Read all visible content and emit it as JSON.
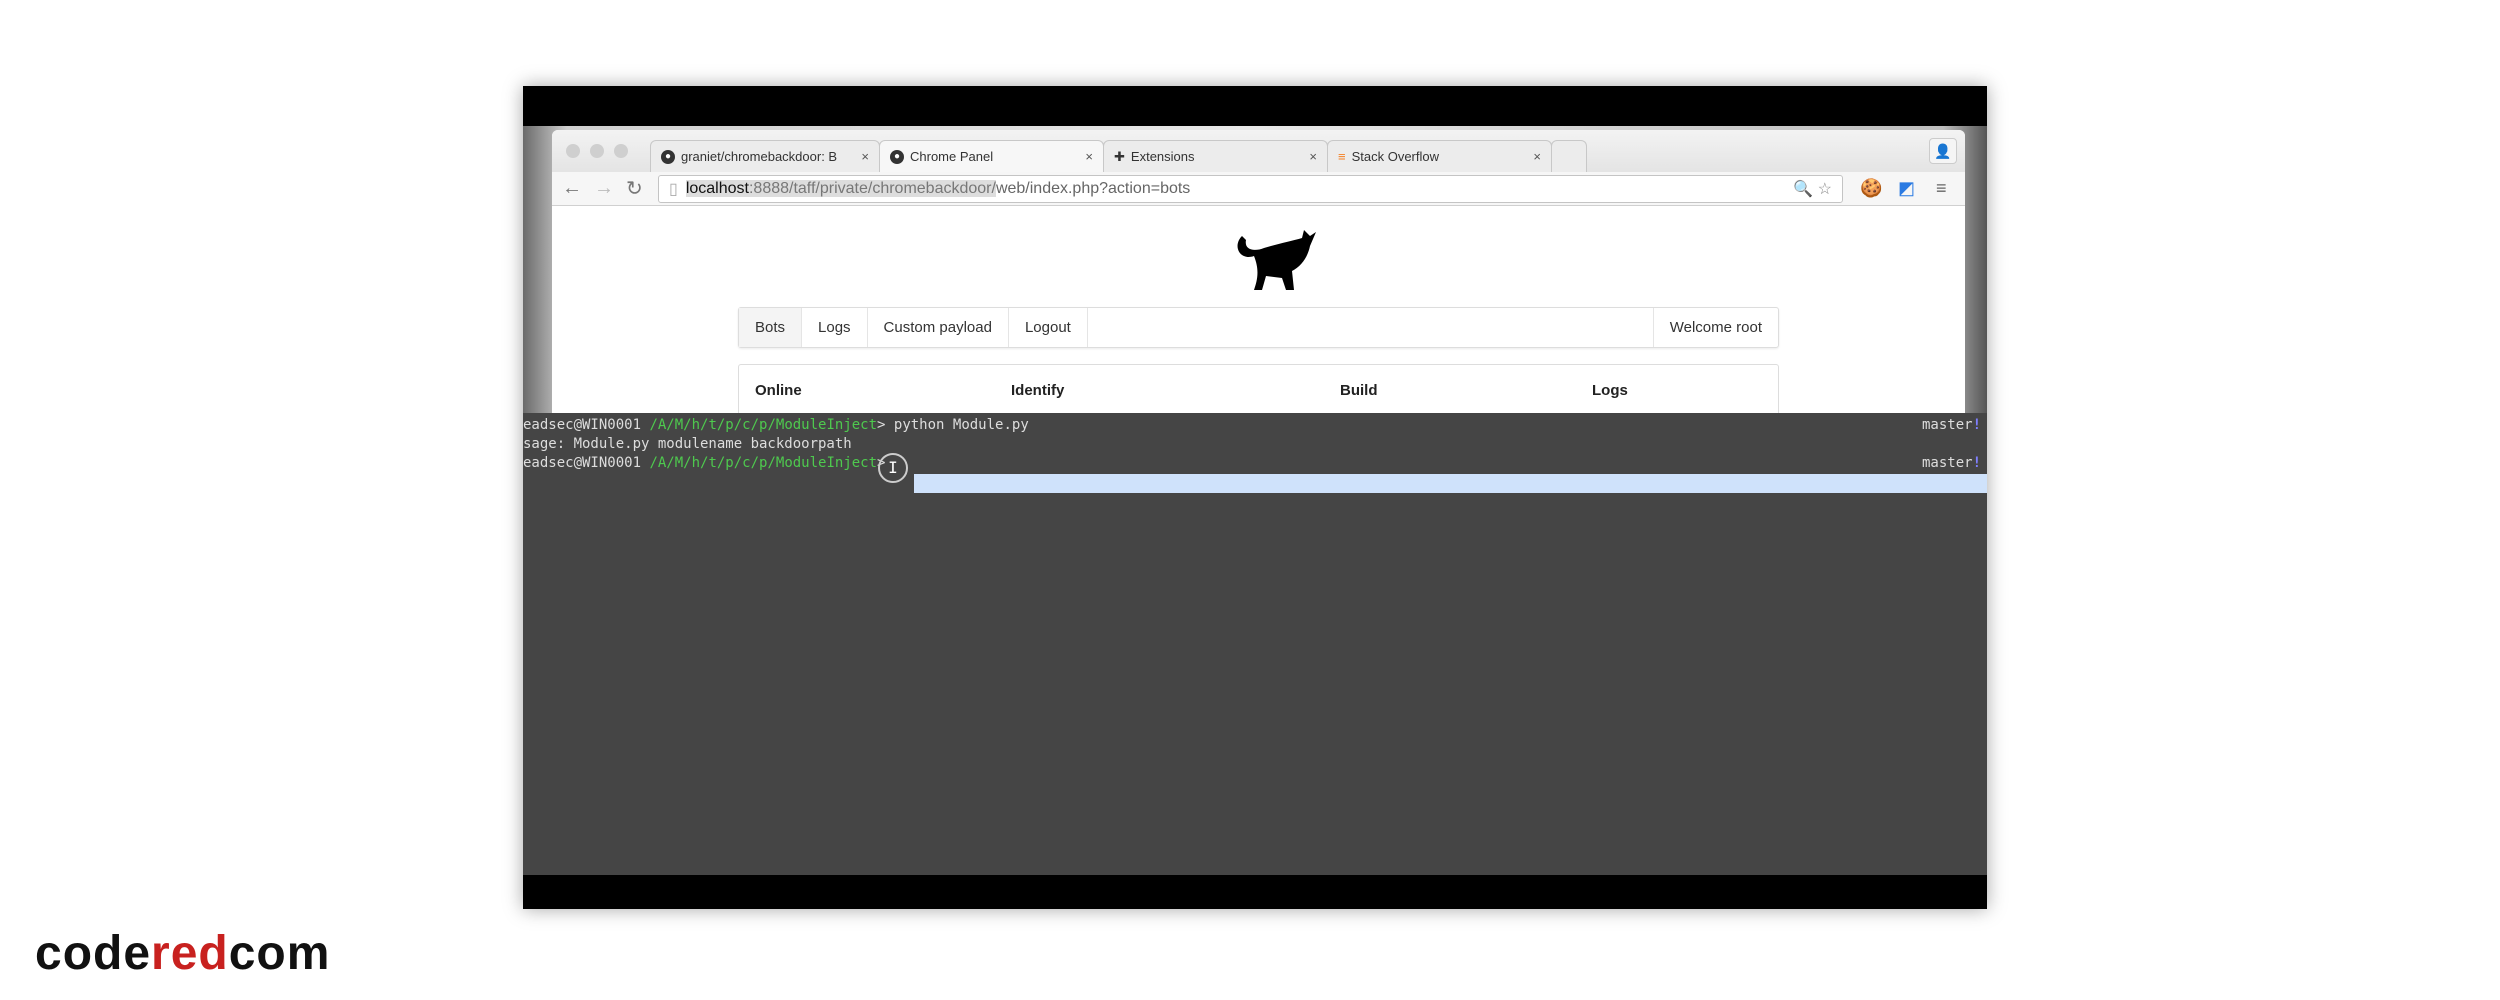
{
  "browser": {
    "tabs": [
      {
        "label": "graniet/chromebackdoor: B",
        "icon": "github-icon"
      },
      {
        "label": "Chrome Panel",
        "icon": "github-icon"
      },
      {
        "label": "Extensions",
        "icon": "puzzle-icon"
      },
      {
        "label": "Stack Overflow",
        "icon": "stackoverflow-icon"
      }
    ],
    "url": {
      "host": "localhost",
      "path_highlight": ":8888/taff/private/chromebackdoor/",
      "path_rest": "web/index.php?action=bots"
    }
  },
  "page": {
    "nav": [
      "Bots",
      "Logs",
      "Custom payload",
      "Logout"
    ],
    "welcome": "Welcome root",
    "columns": [
      "Online",
      "Identify",
      "Build",
      "Logs"
    ]
  },
  "terminal": {
    "lines": [
      {
        "user": "eadsec@WIN0001",
        "path": "/A/M/h/t/p/c/p/ModuleInject",
        "cmd": "> python Module.py",
        "branch": "master",
        "flag": "!"
      },
      {
        "text": "sage: Module.py modulename backdoorpath"
      },
      {
        "user": "eadsec@WIN0001",
        "path": "/A/M/h/t/p/c/p/ModuleInject",
        "cmd": ">",
        "branch": "master",
        "flag": "!"
      }
    ]
  },
  "watermark": {
    "part1": "code",
    "part2": "red",
    "part3": "com"
  }
}
